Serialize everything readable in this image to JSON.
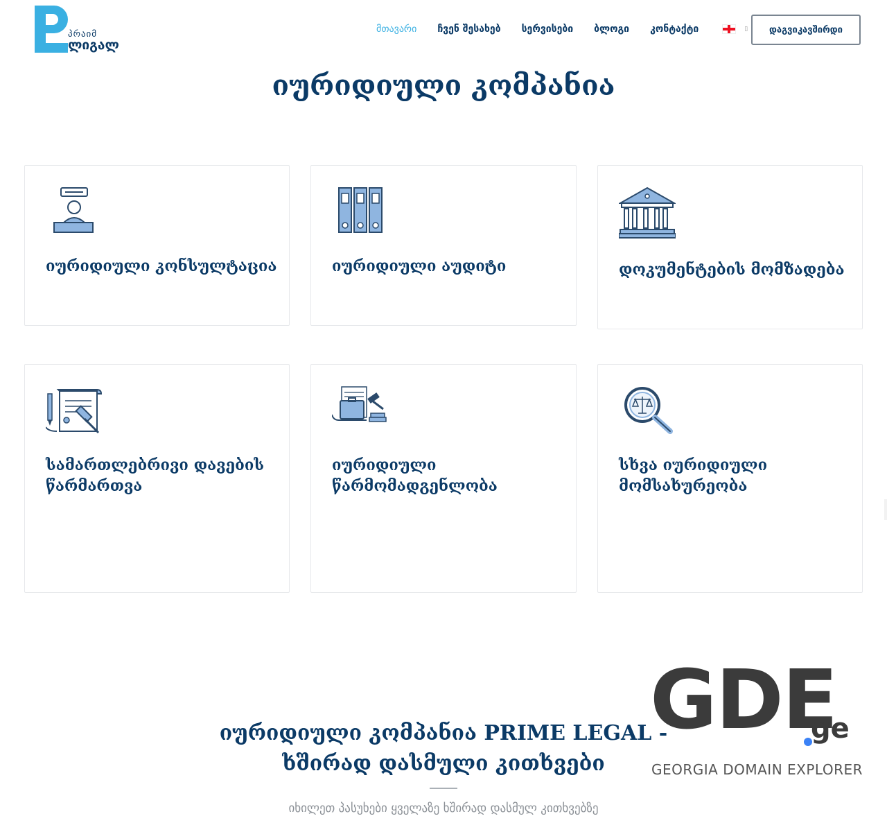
{
  "brand": {
    "logo_top": "პრაიმ",
    "logo_bottom": "ლიგალ",
    "color": "#0b3a66",
    "accent": "#3ab0e2"
  },
  "nav": {
    "items": [
      {
        "label": "მთავარი",
        "active": true
      },
      {
        "label": "ჩვენ შესახებ",
        "active": false
      },
      {
        "label": "სერვისები",
        "active": false
      },
      {
        "label": "ბლოგი",
        "active": false
      },
      {
        "label": "კონტაქტი",
        "active": false
      }
    ],
    "lang_flag": "georgia-flag-icon",
    "cta": "დაგვიკავშირდი"
  },
  "main": {
    "title": "იურიდიული კომპანია",
    "services": [
      {
        "label": "იურიდიული კონსულტაცია",
        "icon": "consultant-icon"
      },
      {
        "label": "იურიდიული აუდიტი",
        "icon": "binders-icon"
      },
      {
        "label": "დოკუმენტების მომზადება",
        "icon": "courthouse-icon"
      },
      {
        "label_lines": [
          "სამართლებრივი დავების",
          "წარმართვა"
        ],
        "icon": "gavel-document-icon"
      },
      {
        "label_lines": [
          "იურიდიული",
          "წარმომადგენლობა"
        ],
        "icon": "briefcase-gavel-icon"
      },
      {
        "label_lines": [
          "სხვა იურიდიული",
          "მომსახურეობა"
        ],
        "icon": "magnifier-scales-icon"
      }
    ]
  },
  "faq": {
    "title_line1": "იურიდიული კომპანია PRIME LEGAL -",
    "title_line2": "ხშირად დასმული კითხვები",
    "subtitle": "იხილეთ პასუხები ყველაზე ხშირად დასმულ კითხვებზე"
  },
  "watermark": {
    "word": "GDE",
    "tld": "ge",
    "tagline": "GEORGIA DOMAIN EXPLORER",
    "dot_color": "#3b82f6"
  }
}
